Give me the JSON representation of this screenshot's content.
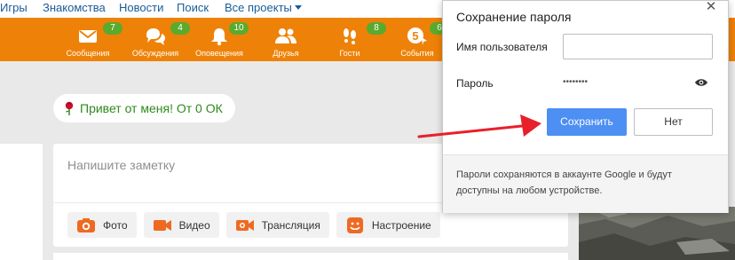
{
  "topbar": {
    "links": [
      "Игры",
      "Знакомства",
      "Новости",
      "Поиск",
      "Все проекты"
    ]
  },
  "nav": {
    "items": [
      {
        "label": "Сообщения",
        "badge": "7",
        "icon": "envelope-icon"
      },
      {
        "label": "Обсуждения",
        "badge": "4",
        "icon": "chat-bubbles-icon"
      },
      {
        "label": "Оповещения",
        "badge": "10",
        "icon": "bell-icon"
      },
      {
        "label": "Друзья",
        "badge": "",
        "icon": "friends-icon"
      },
      {
        "label": "Гости",
        "badge": "8",
        "icon": "footprints-icon"
      },
      {
        "label": "События",
        "badge": "6",
        "icon": "events-icon",
        "icon_number": "5"
      }
    ]
  },
  "greeting": {
    "text": "Привет от меня! От 0 ОК",
    "icon": "rose-icon"
  },
  "note": {
    "placeholder": "Напишите заметку",
    "actions": [
      {
        "label": "Фото",
        "icon": "camera-icon"
      },
      {
        "label": "Видео",
        "icon": "video-camera-icon"
      },
      {
        "label": "Трансляция",
        "icon": "broadcast-icon"
      },
      {
        "label": "Настроение",
        "icon": "mood-icon"
      }
    ]
  },
  "dialog": {
    "title": "Сохранение пароля",
    "username_label": "Имя пользователя",
    "username_value": "",
    "password_label": "Пароль",
    "password_value": "••••••••",
    "save_label": "Сохранить",
    "no_label": "Нет",
    "footer": "Пароли сохраняются в аккаунте Google и будут доступны на любом устройстве."
  },
  "colors": {
    "orange": "#ee8208",
    "badge_green": "#5aaa2d",
    "link_blue": "#1a5c99",
    "greeting_green": "#2e8a1d",
    "save_blue": "#4d8ff3",
    "arrow_red": "#e8202a"
  }
}
